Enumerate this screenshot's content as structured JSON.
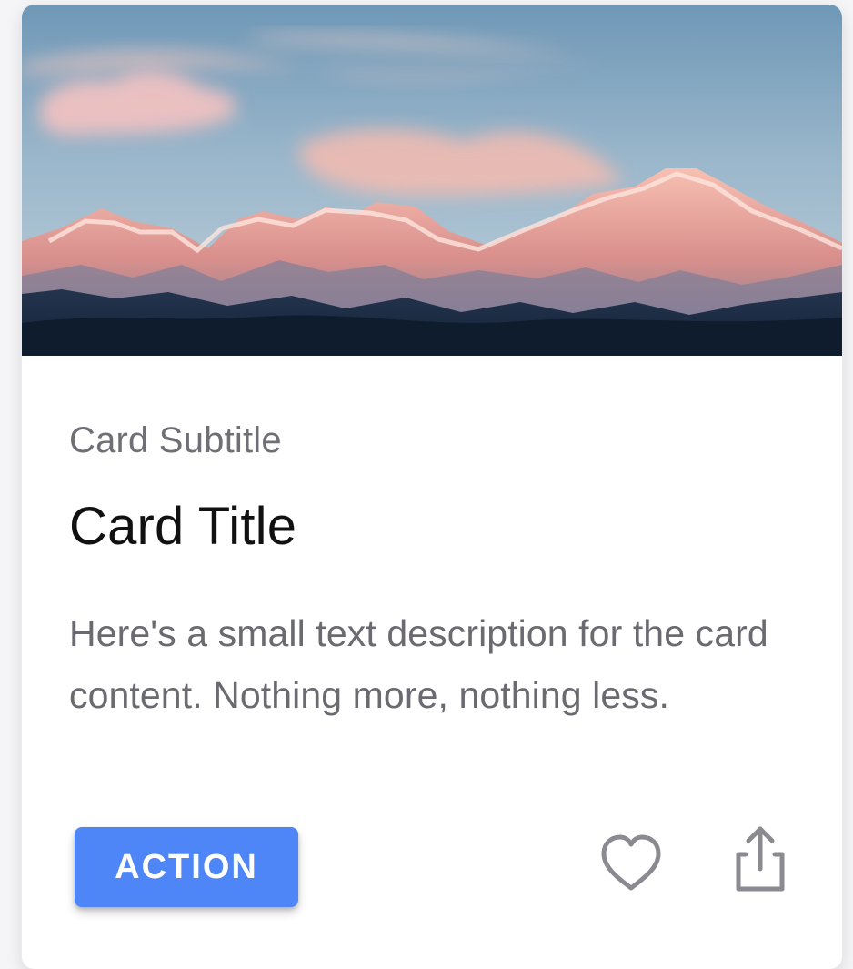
{
  "card": {
    "subtitle": "Card Subtitle",
    "title": "Card Title",
    "description": "Here's a small text description for the card content. Nothing more, nothing less.",
    "action_label": "ACTION",
    "icons": {
      "favorite": "heart-icon",
      "share": "share-icon"
    },
    "colors": {
      "action": "#4f86f7",
      "title": "#111111",
      "text": "#6a6a70",
      "icon": "#8a8a90"
    }
  }
}
